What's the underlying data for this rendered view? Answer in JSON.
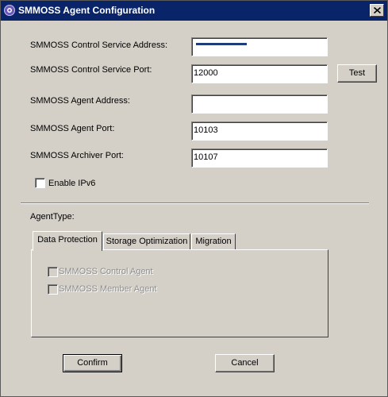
{
  "window": {
    "title": "SMMOSS Agent Configuration",
    "title_bar_color": "#0a246a",
    "background_color": "#d4d0c8"
  },
  "form": {
    "control_service_address": {
      "label": "SMMOSS Control Service Address:",
      "value": ""
    },
    "control_service_port": {
      "label": "SMMOSS Control Service Port:",
      "value": "12000"
    },
    "agent_address": {
      "label": "SMMOSS Agent Address:",
      "value": ""
    },
    "agent_port": {
      "label": "SMMOSS Agent Port:",
      "value": "10103"
    },
    "archiver_port": {
      "label": "SMMOSS Archiver Port:",
      "value": "10107"
    },
    "test_button": "Test",
    "enable_ipv6": {
      "label": "Enable IPv6",
      "checked": false
    }
  },
  "agent_type": {
    "label": "AgentType:",
    "tabs": [
      {
        "label": "Data Protection",
        "active": true
      },
      {
        "label": "Storage Optimization",
        "active": false
      },
      {
        "label": "Migration",
        "active": false
      }
    ],
    "options": [
      {
        "label": "SMMOSS Control Agent",
        "checked": false,
        "enabled": false
      },
      {
        "label": "SMMOSS Member Agent",
        "checked": false,
        "enabled": false
      }
    ]
  },
  "buttons": {
    "confirm": "Confirm",
    "cancel": "Cancel"
  },
  "icons": {
    "app": "app-logo-icon",
    "close": "close-icon"
  }
}
